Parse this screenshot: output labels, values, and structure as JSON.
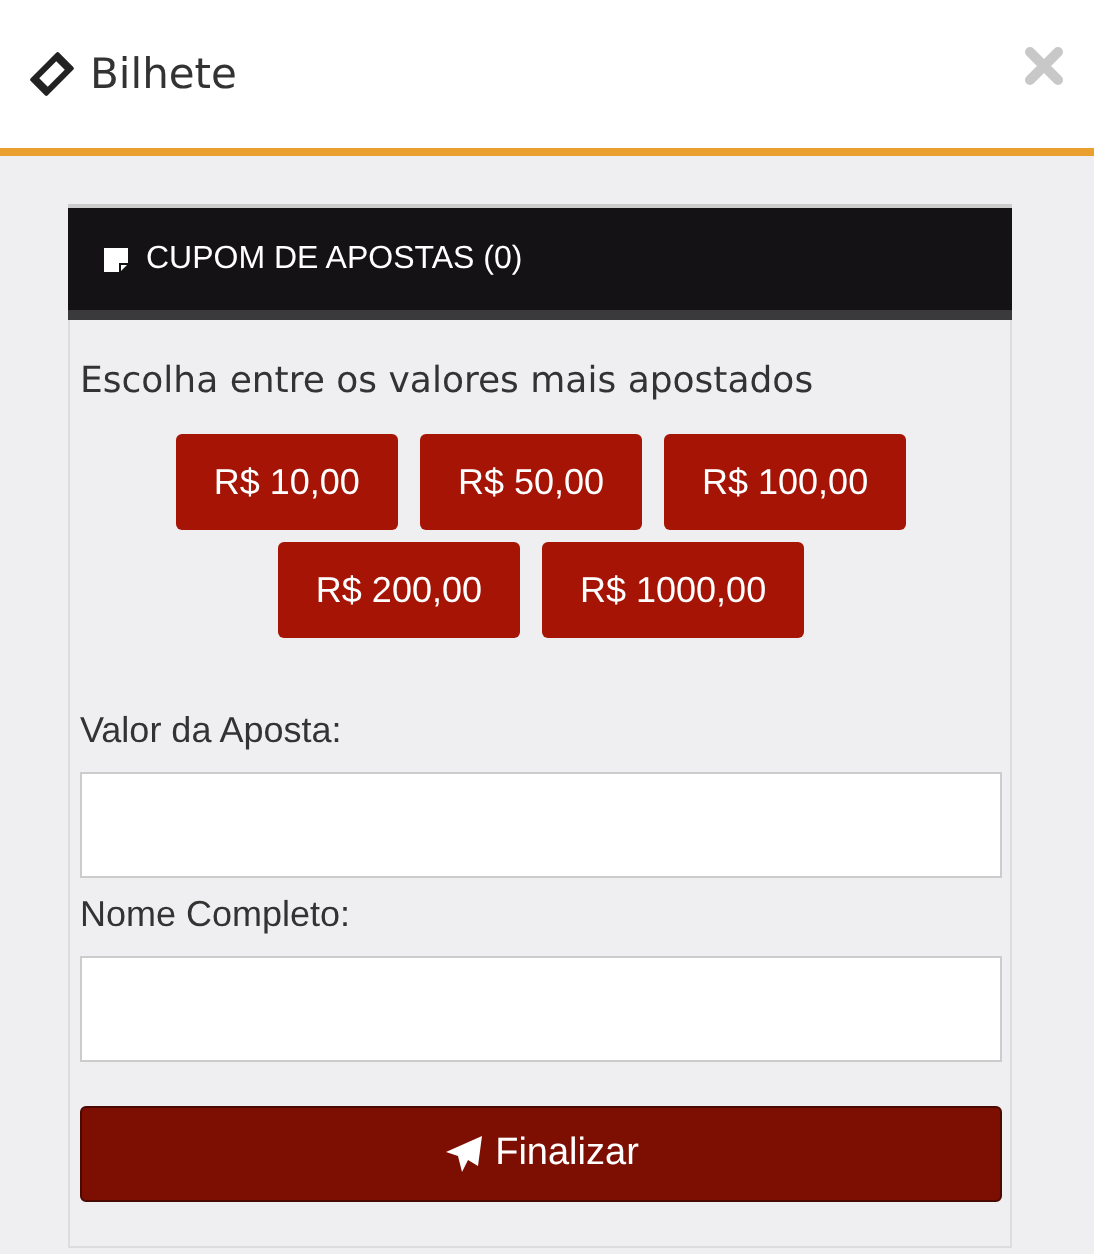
{
  "window": {
    "title": "Bilhete"
  },
  "coupon": {
    "title": "CUPOM DE APOSTAS (0)"
  },
  "prompt": "Escolha entre os valores mais apostados",
  "amounts": [
    [
      "R$ 10,00",
      "R$ 50,00",
      "R$ 100,00"
    ],
    [
      "R$ 200,00",
      "R$ 1000,00"
    ]
  ],
  "fields": [
    {
      "label": "Valor da Aposta:"
    },
    {
      "label": "Nome Completo:"
    }
  ],
  "submit": {
    "label": "Finalizar"
  }
}
